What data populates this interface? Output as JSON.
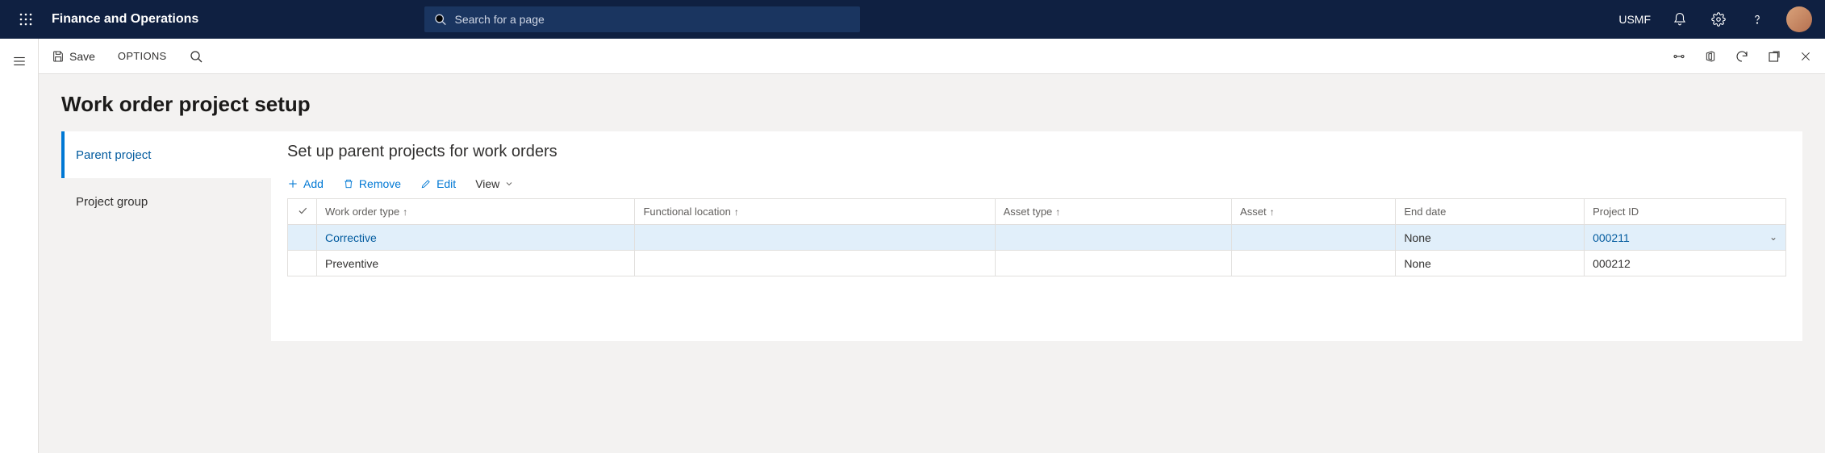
{
  "theme": {
    "dark": "#0f2041",
    "accent": "#0078d4"
  },
  "header": {
    "app_title": "Finance and Operations",
    "search_placeholder": "Search for a page",
    "company": "USMF"
  },
  "commandbar": {
    "save_label": "Save",
    "options_label": "OPTIONS"
  },
  "page": {
    "title": "Work order project setup",
    "tabs": [
      {
        "label": "Parent project",
        "active": true
      },
      {
        "label": "Project group",
        "active": false
      }
    ]
  },
  "section": {
    "title": "Set up parent projects for work orders",
    "toolbar": {
      "add_label": "Add",
      "remove_label": "Remove",
      "edit_label": "Edit",
      "view_label": "View"
    }
  },
  "table": {
    "columns": [
      {
        "key": "work_order_type",
        "label": "Work order type",
        "sorted": true
      },
      {
        "key": "functional_location",
        "label": "Functional location",
        "sorted": true
      },
      {
        "key": "asset_type",
        "label": "Asset type",
        "sorted": true
      },
      {
        "key": "asset",
        "label": "Asset",
        "sorted": true
      },
      {
        "key": "end_date",
        "label": "End date",
        "sorted": false
      },
      {
        "key": "project_id",
        "label": "Project ID",
        "sorted": false
      }
    ],
    "rows": [
      {
        "selected": true,
        "work_order_type": "Corrective",
        "functional_location": "",
        "asset_type": "",
        "asset": "",
        "end_date": "None",
        "project_id": "000211"
      },
      {
        "selected": false,
        "work_order_type": "Preventive",
        "functional_location": "",
        "asset_type": "",
        "asset": "",
        "end_date": "None",
        "project_id": "000212"
      }
    ]
  }
}
